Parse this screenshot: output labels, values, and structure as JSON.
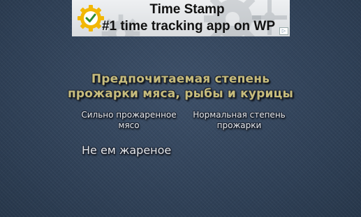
{
  "ad": {
    "line1": "Time Stamp",
    "line2": "#1 time tracking app on WP",
    "logo_icon": "gear-clock-icon",
    "info_icon": "ad-info-icon",
    "accent": "#f2b705"
  },
  "question": {
    "title_line1": "Предпочитаемая степень",
    "title_line2": "прожарки мяса, рыбы и курицы"
  },
  "options": {
    "well_done_line1": "Сильно прожаренное",
    "well_done_line2": "мясо",
    "medium_line1": "Нормальная степень",
    "medium_line2": "прожарки",
    "no_fried": "Не ем жареное"
  },
  "colors": {
    "background": "#34465e",
    "title": "#c7bc7c",
    "option_text": "#e3e6ea"
  }
}
